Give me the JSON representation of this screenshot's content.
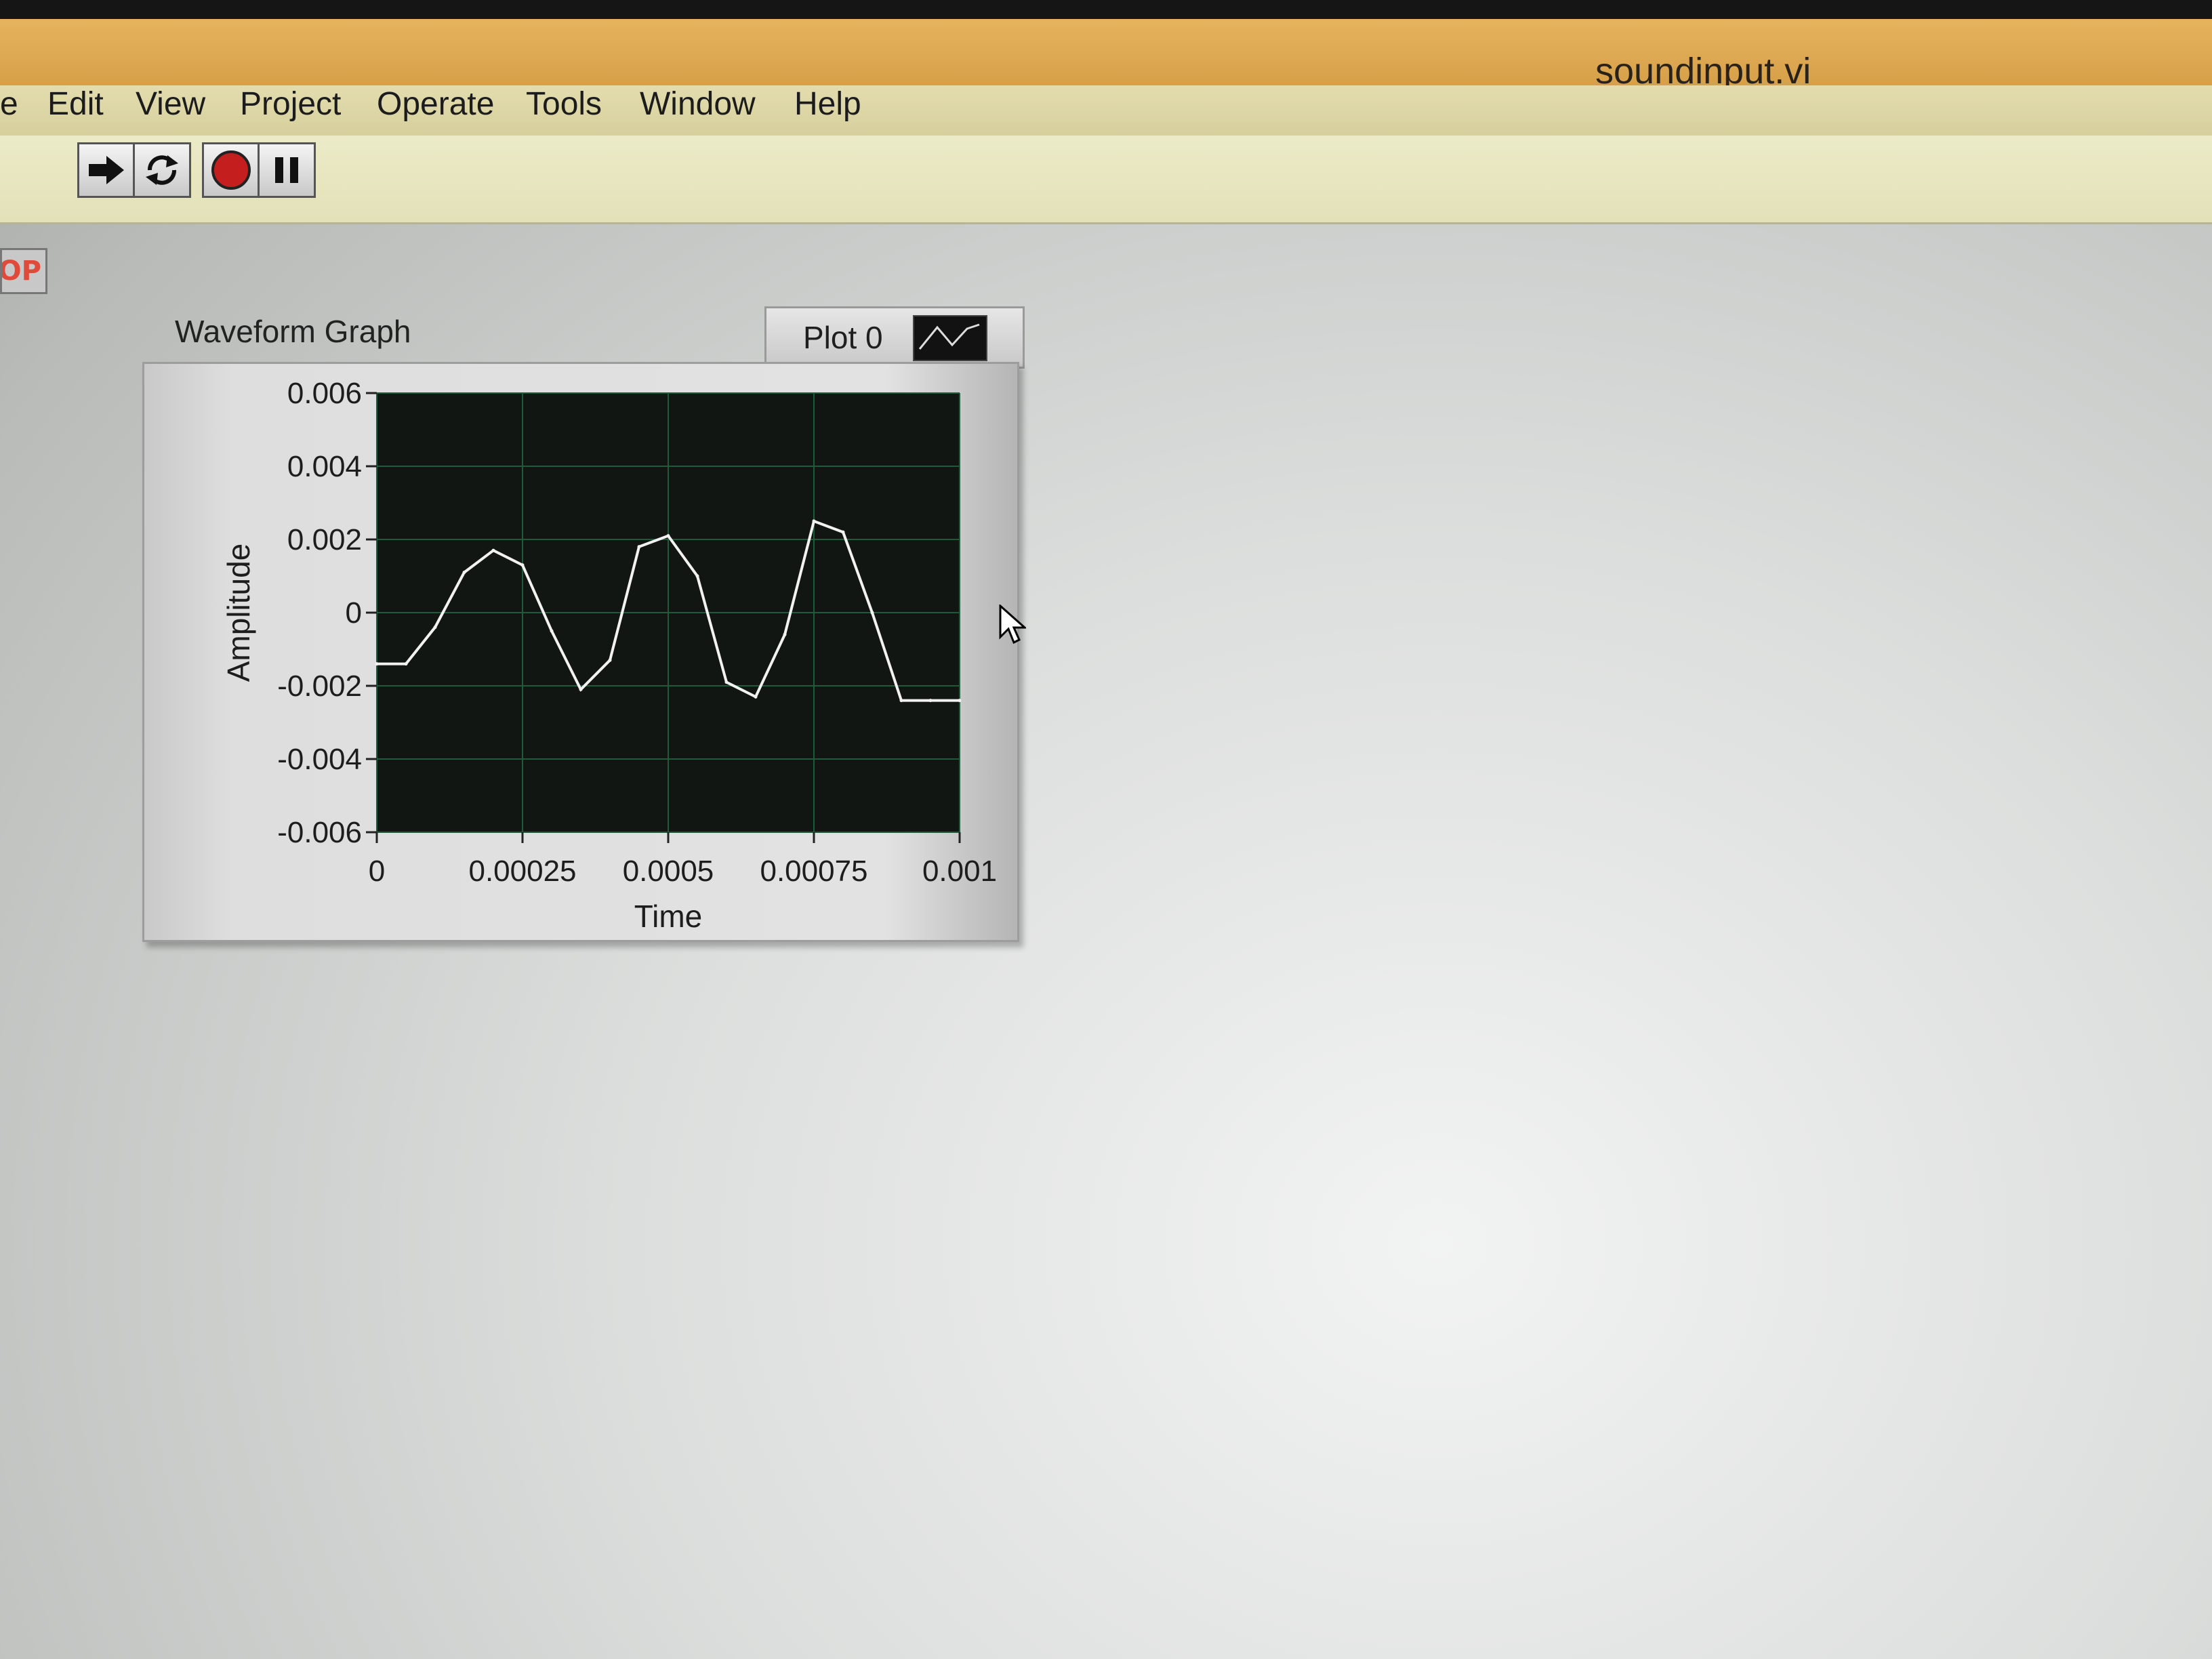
{
  "window": {
    "title": "soundinput.vi"
  },
  "menu": {
    "items": [
      "e",
      "Edit",
      "View",
      "Project",
      "Operate",
      "Tools",
      "Window",
      "Help"
    ]
  },
  "toolbar": {
    "buttons": [
      {
        "name": "run",
        "icon": "run-arrow-icon"
      },
      {
        "name": "run-continuously",
        "icon": "run-continuously-icon"
      },
      {
        "name": "abort",
        "icon": "abort-stop-icon"
      },
      {
        "name": "pause",
        "icon": "pause-icon"
      }
    ]
  },
  "stop_button": {
    "label": "OP"
  },
  "graph": {
    "label": "Waveform Graph",
    "legend_label": "Plot 0"
  },
  "chart_data": {
    "type": "line",
    "title": "Waveform Graph",
    "xlabel": "Time",
    "ylabel": "Amplitude",
    "xlim": [
      0,
      0.001
    ],
    "ylim": [
      -0.006,
      0.006
    ],
    "xticks": [
      "0",
      "0.00025",
      "0.0005",
      "0.00075",
      "0.001"
    ],
    "yticks": [
      "0.006",
      "0.004",
      "0.002",
      "0",
      "-0.002",
      "-0.004",
      "-0.006"
    ],
    "grid": true,
    "colors": {
      "plot_bg": "#111612",
      "grid": "#1f5a3a",
      "trace": "#f2f2f2"
    },
    "series": [
      {
        "name": "Plot 0",
        "x": [
          0,
          5e-05,
          0.0001,
          0.00015,
          0.0002,
          0.00025,
          0.0003,
          0.00035,
          0.0004,
          0.00045,
          0.0005,
          0.00055,
          0.0006,
          0.00065,
          0.0007,
          0.00075,
          0.0008,
          0.00085,
          0.0009,
          0.00095,
          0.001
        ],
        "y": [
          -0.0014,
          -0.0014,
          -0.0004,
          0.0011,
          0.0017,
          0.0013,
          -0.0005,
          -0.0021,
          -0.0013,
          0.0018,
          0.0021,
          0.001,
          -0.0019,
          -0.0023,
          -0.0006,
          0.0025,
          0.0022,
          0.0,
          -0.0024,
          -0.0024,
          -0.0024
        ]
      }
    ]
  }
}
